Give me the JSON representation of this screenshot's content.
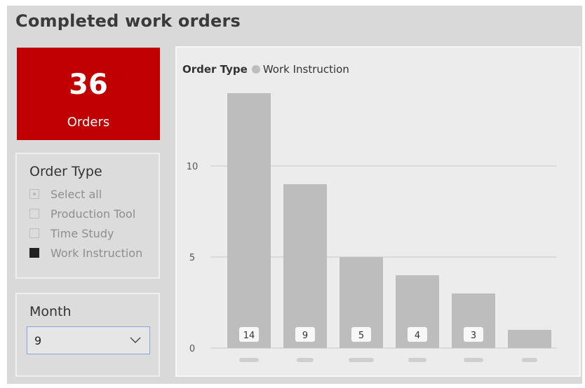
{
  "page": {
    "title": "Completed work orders"
  },
  "kpi": {
    "value": "36",
    "label": "Orders",
    "color": "#c00000"
  },
  "order_type_slicer": {
    "title": "Order Type",
    "options": [
      {
        "label": "Select all",
        "state": "partial"
      },
      {
        "label": "Production Tool",
        "state": "unchecked"
      },
      {
        "label": "Time Study",
        "state": "unchecked"
      },
      {
        "label": "Work Instruction",
        "state": "checked"
      }
    ]
  },
  "month_slicer": {
    "title": "Month",
    "selected": "9",
    "icon": "chevron-down-icon"
  },
  "chart_data": {
    "type": "bar",
    "legend_title": "Order Type",
    "series": [
      {
        "name": "Work Instruction",
        "values": [
          14,
          9,
          5,
          4,
          3,
          1
        ],
        "color": "#bdbdbd"
      }
    ],
    "categories": [
      "",
      "",
      "",
      "",
      "",
      ""
    ],
    "data_labels": [
      "14",
      "9",
      "5",
      "4",
      "3",
      ""
    ],
    "yticks": [
      "0",
      "5",
      "10"
    ],
    "ylim": [
      0,
      15
    ],
    "grid": true,
    "legend_position": "top-left"
  }
}
